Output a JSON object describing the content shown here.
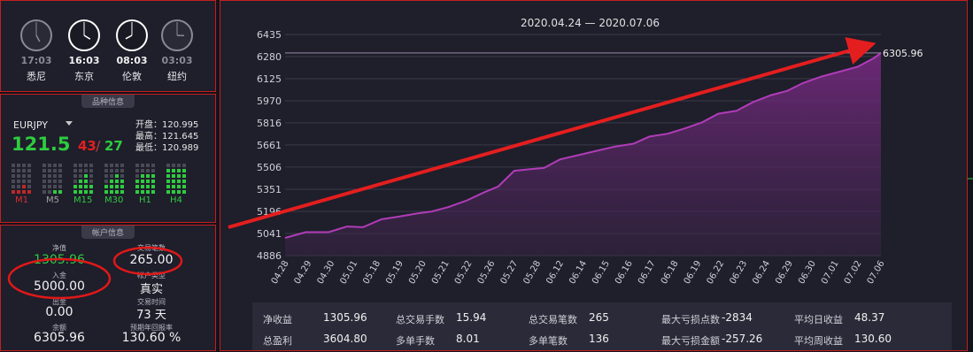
{
  "clocks": [
    {
      "time": "17:03",
      "city": "悉尼",
      "dim": true
    },
    {
      "time": "16:03",
      "city": "东京",
      "dim": false
    },
    {
      "time": "08:03",
      "city": "伦敦",
      "dim": false
    },
    {
      "time": "03:03",
      "city": "纽约",
      "dim": true
    }
  ],
  "instrument": {
    "tab": "品种信息",
    "symbol": "EURJPY",
    "price_main": "121.5",
    "price_red": "43",
    "price_sep": "/",
    "price_green": "27",
    "open": "开盘：120.995",
    "high": "最高：121.645",
    "low": "最低：120.989",
    "timeframes": [
      {
        "label": "M1",
        "color": "#d03030"
      },
      {
        "label": "M5",
        "color": "#a0a0a0"
      },
      {
        "label": "M15",
        "color": "#2ecc40"
      },
      {
        "label": "M30",
        "color": "#2ecc40"
      },
      {
        "label": "H1",
        "color": "#2ecc40"
      },
      {
        "label": "H4",
        "color": "#2ecc40"
      }
    ]
  },
  "account": {
    "tab": "帐户信息",
    "net_label": "净值",
    "net_value": "1305.96",
    "trades_label": "交易笔数",
    "trades_value": "265.00",
    "deposit_label": "入金",
    "deposit_value": "5000.00",
    "account_type_label": "帐户类型",
    "account_type_value": "真实",
    "withdraw_label": "出金",
    "withdraw_value": "0.00",
    "trade_time_label": "交易时间",
    "trade_time_value": "73 天",
    "balance_label": "余额",
    "balance_value": "6305.96",
    "annual_label": "预期年回报率",
    "annual_value": "130.60 %"
  },
  "chart_data": {
    "type": "area",
    "title": "2020.04.24 — 2020.07.06",
    "yticks": [
      "6435",
      "6280",
      "6125",
      "5970",
      "5816",
      "5661",
      "5506",
      "5351",
      "5196",
      "5041",
      "4886"
    ],
    "ylim": [
      4886,
      6435
    ],
    "categories": [
      "04.28",
      "04.29",
      "04.30",
      "05.01",
      "05.18",
      "05.19",
      "05.20",
      "05.21",
      "05.22",
      "05.26",
      "05.27",
      "05.28",
      "06.12",
      "06.14",
      "06.15",
      "06.16",
      "06.17",
      "06.18",
      "06.19",
      "06.22",
      "06.23",
      "06.24",
      "06.29",
      "06.30",
      "07.01",
      "07.02",
      "07.06"
    ],
    "x_index": [
      0,
      0.9,
      1.9,
      2.7,
      3.4,
      4.2,
      5.0,
      5.7,
      6.4,
      7.1,
      7.9,
      8.7,
      9.3,
      10.0,
      10.6,
      11.3,
      12.0,
      12.8,
      13.6,
      14.4,
      15.2,
      15.9,
      16.7,
      17.5,
      18.2,
      18.9,
      19.7,
      20.4,
      21.2,
      21.9,
      22.6,
      23.4,
      24.2,
      25.0,
      25.7,
      26.0
    ],
    "values": [
      5010,
      5050,
      5050,
      5090,
      5085,
      5140,
      5160,
      5180,
      5195,
      5225,
      5270,
      5330,
      5370,
      5480,
      5490,
      5500,
      5560,
      5590,
      5620,
      5650,
      5670,
      5720,
      5740,
      5780,
      5820,
      5880,
      5900,
      5960,
      6010,
      6040,
      6095,
      6140,
      6175,
      6210,
      6270,
      6305.96
    ],
    "end_label": "6305.96",
    "color": "#b03cb8"
  },
  "stats": [
    {
      "label": "净收益",
      "value": "1305.96"
    },
    {
      "label": "总交易手数",
      "value": "15.94"
    },
    {
      "label": "总交易笔数",
      "value": "265"
    },
    {
      "label": "最大亏损点数",
      "value": "-2834"
    },
    {
      "label": "平均日收益",
      "value": "48.37"
    },
    {
      "label": "总盈利",
      "value": "3604.80"
    },
    {
      "label": "多单手数",
      "value": "8.01"
    },
    {
      "label": "多单笔数",
      "value": "136"
    },
    {
      "label": "最大亏损金额",
      "value": "-257.26"
    },
    {
      "label": "平均周收益",
      "value": "130.60"
    }
  ]
}
